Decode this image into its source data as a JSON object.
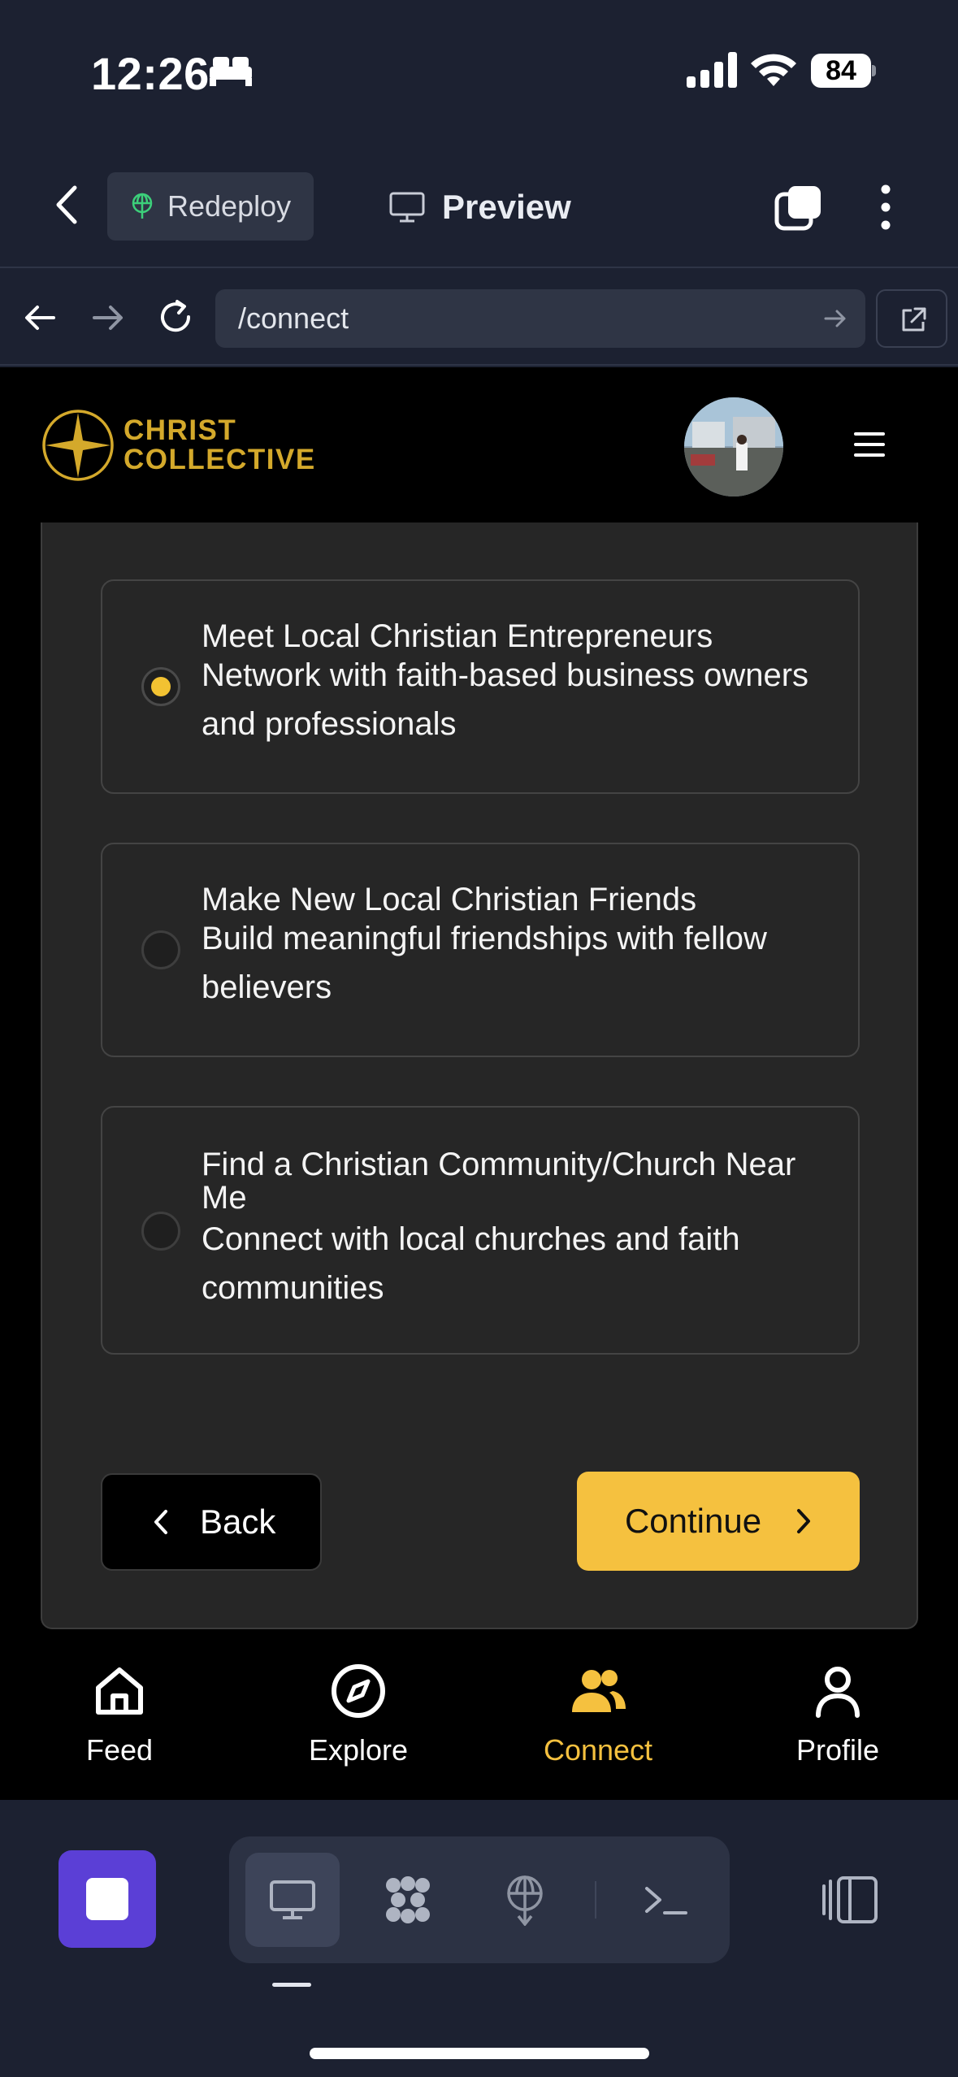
{
  "status_bar": {
    "time": "12:26",
    "battery": "84"
  },
  "toolbar": {
    "redeploy_label": "Redeploy",
    "preview_label": "Preview"
  },
  "url_bar": {
    "path": "/connect"
  },
  "brand": {
    "line1": "CHRIST",
    "line2": "COLLECTIVE",
    "color": "#d4a92b"
  },
  "options": [
    {
      "title": "Meet Local Christian Entrepreneurs",
      "description": "Network with faith-based business owners and professionals",
      "selected": true
    },
    {
      "title": "Make New Local Christian Friends",
      "description": "Build meaningful friendships with fellow believers",
      "selected": false
    },
    {
      "title": "Find a Christian Community/Church Near Me",
      "description": "Connect with local churches and faith communities",
      "selected": false
    }
  ],
  "actions": {
    "back_label": "Back",
    "continue_label": "Continue"
  },
  "app_nav": {
    "items": [
      {
        "label": "Feed",
        "icon": "home-icon"
      },
      {
        "label": "Explore",
        "icon": "compass-icon"
      },
      {
        "label": "Connect",
        "icon": "users-icon",
        "active": true
      },
      {
        "label": "Profile",
        "icon": "user-icon"
      }
    ]
  },
  "colors": {
    "accent": "#f5c13f",
    "chrome_bg": "#1c2131",
    "stop_button": "#5b3fd6"
  }
}
